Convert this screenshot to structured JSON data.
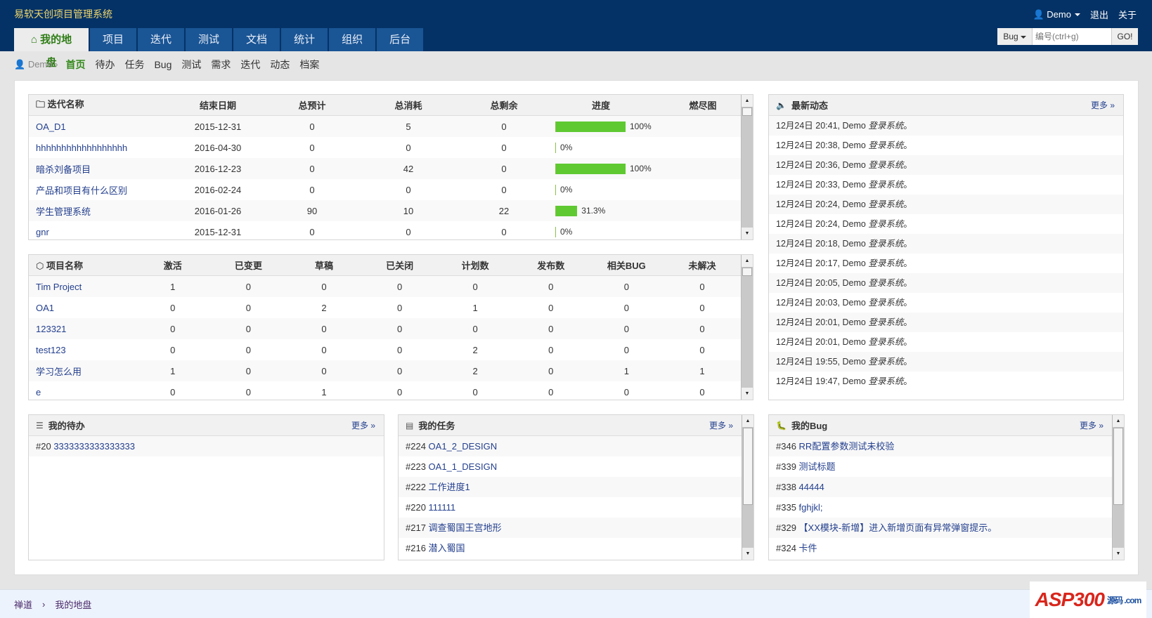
{
  "header": {
    "app_title": "易软天创项目管理系统",
    "user": "Demo",
    "logout": "退出",
    "about": "关于",
    "tabs": [
      {
        "label": "我的地盘",
        "active": true
      },
      {
        "label": "项目"
      },
      {
        "label": "迭代"
      },
      {
        "label": "测试"
      },
      {
        "label": "文档"
      },
      {
        "label": "统计"
      },
      {
        "label": "组织"
      },
      {
        "label": "后台"
      }
    ],
    "search": {
      "type": "Bug",
      "placeholder": "编号(ctrl+g)",
      "go": "GO!"
    }
  },
  "subnav": {
    "crumb": "Demo",
    "items": [
      {
        "label": "首页",
        "active": true
      },
      {
        "label": "待办"
      },
      {
        "label": "任务"
      },
      {
        "label": "Bug"
      },
      {
        "label": "测试"
      },
      {
        "label": "需求"
      },
      {
        "label": "迭代"
      },
      {
        "label": "动态"
      },
      {
        "label": "档案"
      }
    ]
  },
  "iterations": {
    "headers": [
      "迭代名称",
      "结束日期",
      "总预计",
      "总消耗",
      "总剩余",
      "进度",
      "燃尽图"
    ],
    "rows": [
      {
        "name": "OA_D1",
        "end": "2015-12-31",
        "estimate": "0",
        "consumed": "5",
        "left": "0",
        "progress": 100,
        "progress_label": "100%"
      },
      {
        "name": "hhhhhhhhhhhhhhhhhh",
        "end": "2016-04-30",
        "estimate": "0",
        "consumed": "0",
        "left": "0",
        "progress": 0,
        "progress_label": "0%"
      },
      {
        "name": "暗杀刘备项目",
        "end": "2016-12-23",
        "estimate": "0",
        "consumed": "42",
        "left": "0",
        "progress": 100,
        "progress_label": "100%"
      },
      {
        "name": "产品和项目有什么区别",
        "end": "2016-02-24",
        "estimate": "0",
        "consumed": "0",
        "left": "0",
        "progress": 0,
        "progress_label": "0%"
      },
      {
        "name": "学生管理系统",
        "end": "2016-01-26",
        "estimate": "90",
        "consumed": "10",
        "left": "22",
        "progress": 31.3,
        "progress_label": "31.3%"
      },
      {
        "name": "gnr",
        "end": "2015-12-31",
        "estimate": "0",
        "consumed": "0",
        "left": "0",
        "progress": 0,
        "progress_label": "0%"
      }
    ]
  },
  "projects": {
    "headers": [
      "项目名称",
      "激活",
      "已变更",
      "草稿",
      "已关闭",
      "计划数",
      "发布数",
      "相关BUG",
      "未解决"
    ],
    "rows": [
      [
        "Tim Project",
        "1",
        "0",
        "0",
        "0",
        "0",
        "0",
        "0",
        "0"
      ],
      [
        "OA1",
        "0",
        "0",
        "2",
        "0",
        "1",
        "0",
        "0",
        "0"
      ],
      [
        "123321",
        "0",
        "0",
        "0",
        "0",
        "0",
        "0",
        "0",
        "0"
      ],
      [
        "test123",
        "0",
        "0",
        "0",
        "0",
        "2",
        "0",
        "0",
        "0"
      ],
      [
        "学习怎么用",
        "1",
        "0",
        "0",
        "0",
        "2",
        "0",
        "1",
        "1"
      ],
      [
        "e",
        "0",
        "0",
        "1",
        "0",
        "0",
        "0",
        "0",
        "0"
      ]
    ]
  },
  "dynamics": {
    "title": "最新动态",
    "more": "更多",
    "items": [
      {
        "time": "12月24日 20:41, Demo",
        "action": "登录系统",
        "end": "。"
      },
      {
        "time": "12月24日 20:38, Demo",
        "action": "登录系统",
        "end": "。"
      },
      {
        "time": "12月24日 20:36, Demo",
        "action": "登录系统",
        "end": "。"
      },
      {
        "time": "12月24日 20:33, Demo",
        "action": "登录系统",
        "end": "。"
      },
      {
        "time": "12月24日 20:24, Demo",
        "action": "登录系统",
        "end": "。"
      },
      {
        "time": "12月24日 20:24, Demo",
        "action": "登录系统",
        "end": "。"
      },
      {
        "time": "12月24日 20:18, Demo",
        "action": "登录系统",
        "end": "。"
      },
      {
        "time": "12月24日 20:17, Demo",
        "action": "登录系统",
        "end": "。"
      },
      {
        "time": "12月24日 20:05, Demo",
        "action": "登录系统",
        "end": "。"
      },
      {
        "time": "12月24日 20:03, Demo",
        "action": "登录系统",
        "end": "。"
      },
      {
        "time": "12月24日 20:01, Demo",
        "action": "登录系统",
        "end": "。"
      },
      {
        "time": "12月24日 20:01, Demo",
        "action": "登录系统",
        "end": "。"
      },
      {
        "time": "12月24日 19:55, Demo",
        "action": "登录系统",
        "end": "。"
      },
      {
        "time": "12月24日 19:47, Demo",
        "action": "登录系统",
        "end": "。"
      }
    ]
  },
  "todo": {
    "title": "我的待办",
    "more": "更多",
    "items": [
      {
        "id": "#20",
        "title": "3333333333333333"
      }
    ]
  },
  "tasks": {
    "title": "我的任务",
    "more": "更多",
    "items": [
      {
        "id": "#224",
        "title": "OA1_2_DESIGN"
      },
      {
        "id": "#223",
        "title": "OA1_1_DESIGN"
      },
      {
        "id": "#222",
        "title": "工作进度1"
      },
      {
        "id": "#220",
        "title": "111111"
      },
      {
        "id": "#217",
        "title": "调查蜀国王宫地形"
      },
      {
        "id": "#216",
        "title": "潜入蜀国"
      }
    ]
  },
  "bugs": {
    "title": "我的Bug",
    "more": "更多",
    "items": [
      {
        "id": "#346",
        "title": "RR配置参数测试未校验"
      },
      {
        "id": "#339",
        "title": "测试标题"
      },
      {
        "id": "#338",
        "title": "44444"
      },
      {
        "id": "#335",
        "title": "fghjkl;"
      },
      {
        "id": "#329",
        "title": "【XX模块-新增】进入新增页面有异常弹窗提示。"
      },
      {
        "id": "#324",
        "title": "卡件"
      }
    ]
  },
  "footer": {
    "crumbs": [
      "禅道",
      "我的地盘"
    ]
  },
  "watermark": {
    "text": "ASP300",
    "sub": "源码 .com"
  },
  "colors": {
    "header": "#043266",
    "tab": "#1a5595",
    "active_green": "#348a1b",
    "progress": "#5fc932",
    "link": "#24408e"
  }
}
